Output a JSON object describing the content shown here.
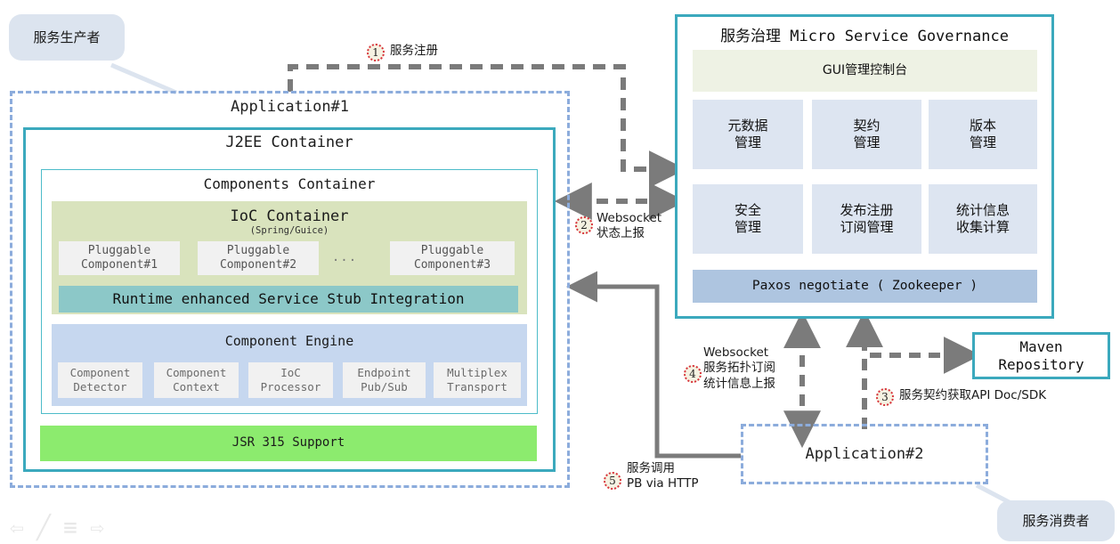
{
  "bubbles": {
    "producer": "服务生产者",
    "consumer": "服务消费者"
  },
  "application1": {
    "title": "Application#1",
    "j2ee": {
      "title": "J2EE Container",
      "components_container": {
        "title": "Components Container",
        "ioc": {
          "title": "IoC Container",
          "subtitle": "(Spring/Guice)",
          "pluggables": [
            "Pluggable\nComponent#1",
            "Pluggable\nComponent#2",
            "Pluggable\nComponent#3"
          ],
          "ellipsis": "...",
          "stub_bar": "Runtime enhanced Service Stub Integration"
        },
        "engine": {
          "title": "Component Engine",
          "cells": [
            "Component\nDetector",
            "Component\nContext",
            "IoC\nProcessor",
            "Endpoint\nPub/Sub",
            "Multiplex\nTransport"
          ]
        }
      },
      "jsr_bar": "JSR 315 Support"
    }
  },
  "application2": {
    "title": "Application#2"
  },
  "governance": {
    "title": "服务治理 Micro Service Governance",
    "gui_bar": "GUI管理控制台",
    "cells": [
      "元数据\n管理",
      "契约\n管理",
      "版本\n管理",
      "安全\n管理",
      "发布注册\n订阅管理",
      "统计信息\n收集计算"
    ],
    "paxos_bar": "Paxos negotiate ( Zookeeper )"
  },
  "maven": {
    "title": "Maven\nRepository"
  },
  "steps": [
    {
      "num": "1",
      "label": "服务注册"
    },
    {
      "num": "2",
      "label": "Websocket\n状态上报"
    },
    {
      "num": "3",
      "label": "服务契约获取API Doc/SDK"
    },
    {
      "num": "4",
      "label": "Websocket\n服务拓扑订阅\n统计信息上报"
    },
    {
      "num": "5",
      "label": "服务调用\nPB via HTTP"
    }
  ],
  "toolbar": {
    "icons": [
      "back-arrow-icon",
      "pencil-icon",
      "list-icon",
      "forward-arrow-icon"
    ],
    "glyphs": [
      "⇦",
      "╱",
      "≡",
      "⇨"
    ]
  },
  "colors": {
    "dashed_blue": "#8cacdc",
    "teal": "#3ba9bd",
    "ioc_green": "#d9e3bd",
    "stub_teal": "#8cc8c8",
    "engine_blue": "#c6d7ef",
    "jsr_green": "#8ceb6e",
    "gov_cell": "#dde5f1",
    "paxos": "#aec5e0",
    "arrow_gray": "#7b7b7b",
    "badge_red": "#d8343c"
  }
}
